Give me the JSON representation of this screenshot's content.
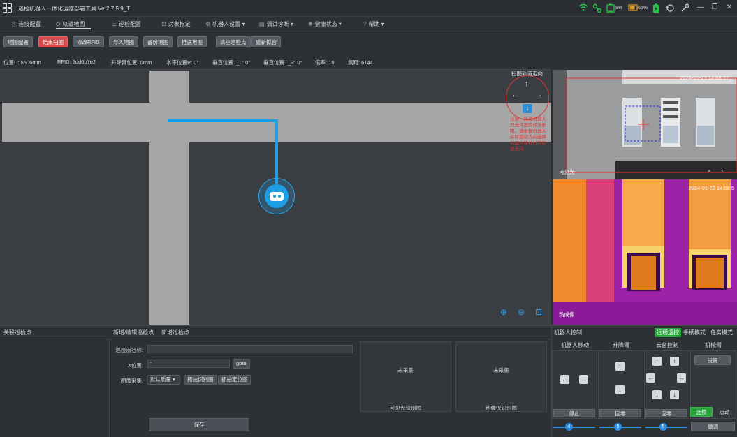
{
  "titlebar": {
    "title": "巡检机器人一体化运维部署工具  Ver2.7.5.9_T",
    "battery1": "8%",
    "battery2": "65%",
    "icons": [
      "grid-logo-icon",
      "wifi-icon",
      "link-icon",
      "battery-icon",
      "battery-icon",
      "battery-charging-icon",
      "refresh-icon",
      "settings-icon",
      "minimize-icon",
      "restore-icon",
      "close-icon"
    ]
  },
  "nav": {
    "items": [
      {
        "label": "连接配置",
        "icon": "link-icon"
      },
      {
        "label": "轨道地图",
        "icon": "map-icon",
        "active": true
      },
      {
        "label": "巡检配置",
        "icon": "list-icon"
      },
      {
        "label": "对象标定",
        "icon": "target-icon"
      },
      {
        "label": "机器人设置",
        "icon": "robot-icon",
        "dropdown": true
      },
      {
        "label": "调试诊断",
        "icon": "debug-icon",
        "dropdown": true
      },
      {
        "label": "健康状态",
        "icon": "health-icon",
        "dropdown": true
      },
      {
        "label": "帮助",
        "icon": "help-icon",
        "dropdown": true
      }
    ]
  },
  "toolbar": {
    "buttons": [
      "地图配置",
      "结束扫图",
      "修改RFID",
      "导入地图",
      "备份地图",
      "推送地图",
      "清空巡检点",
      "重新拟合"
    ]
  },
  "status": {
    "position": "位置D:  5506mm",
    "rfid": "RFID:  2dd6b7e2",
    "lift": "升降臂位置:  0mm",
    "hpos": "水平位置P:  0°",
    "vpos_l": "垂直位置T_L:  0°",
    "vpos_r": "垂直位置T_R:  0°",
    "zoom": "倍率:  10",
    "focus": "焦距:  6144"
  },
  "map": {
    "direction_label": "扫图轨道走向",
    "arrows": {
      "up": "↑",
      "left": "←",
      "right": "→",
      "down": "↓"
    },
    "note": "注意：轨道机器人只允许正向校准地图。请根据机器人实际运动方向选择机器人移动时的轨道走向",
    "zoom_in": "⊕",
    "zoom_out": "⊖",
    "fit": "⊡",
    "colors": {
      "track": "#a6a6a6",
      "path": "#1ea0e8",
      "robot": "#1f9fe3"
    }
  },
  "cameras": {
    "visible": {
      "timestamp": "2024-01-23 14:08:57",
      "label": "可见光"
    },
    "thermal": {
      "timestamp": "2024-01-23 14:08:5",
      "label": "热成像"
    }
  },
  "bottom": {
    "left_title": "关联巡检点",
    "form_title1": "新增/编辑巡检点",
    "form_title2": "新增巡检点",
    "name_label": "巡检点名称:",
    "name_value": "",
    "x_label": "X位置:",
    "x_value": "-",
    "goto": "goto",
    "capture_label": "图像采集:",
    "quality": "默认质量",
    "capture_recog": "抓拍识别图",
    "capture_locate": "抓拍定位图",
    "uncollected1": "未采集",
    "uncollected2": "未采集",
    "visible_recog": "可见光识别图",
    "thermal_recog": "热像仪识别图",
    "save": "保存"
  },
  "control": {
    "title": "机器人控制",
    "modes": [
      "远程遥控",
      "手柄模式",
      "任务模式"
    ],
    "columns": [
      "机器人移动",
      "升降臂",
      "云台控制",
      "机械臂"
    ],
    "stop": "停止",
    "lift_zero": "回零",
    "ptz_zero": "回零",
    "setup": "设置",
    "connect": "连续",
    "jog": "点动",
    "fine": "微调",
    "speed_move": "4",
    "speed_lift": "5",
    "speed_ptz": "5"
  }
}
